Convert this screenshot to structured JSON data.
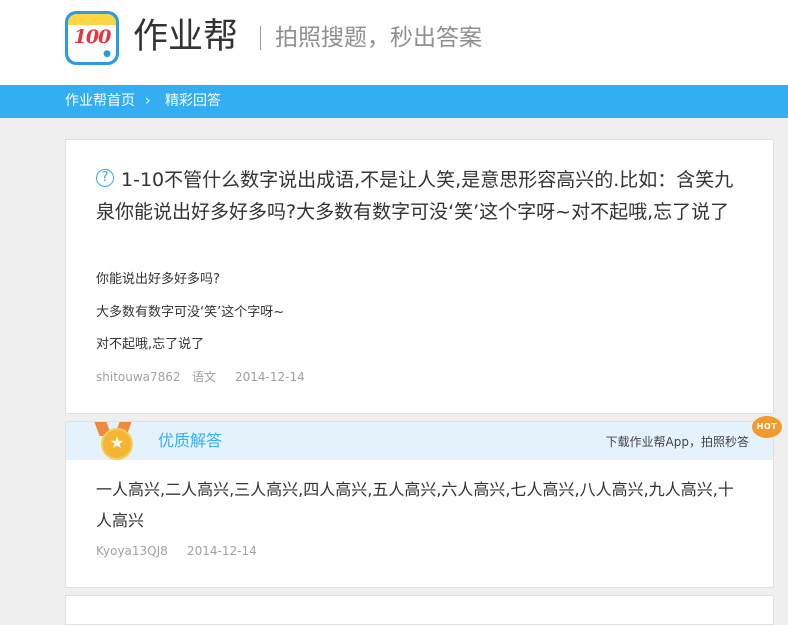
{
  "header": {
    "logo_text": "100",
    "brand": "作业帮",
    "slogan": "拍照搜题，秒出答案"
  },
  "breadcrumb": {
    "home": "作业帮首页",
    "separator": "›",
    "current": "精彩回答"
  },
  "question": {
    "icon": "?",
    "title": "1-10不管什么数字说出成语,不是让人笑,是意思形容高兴的.比如：含笑九泉你能说出好多好多吗?大多数有数字可没‘笑’这个字呀~对不起哦,忘了说了",
    "lines": [
      "你能说出好多好多吗?",
      "大多数有数字可没‘笑’这个字呀~",
      "对不起哦,忘了说了"
    ],
    "user": "shitouwa7862",
    "subject": "语文",
    "date": "2014-12-14"
  },
  "answer": {
    "label": "优质解答",
    "download_text": "下载作业帮App，拍照秒答",
    "hot_badge": "HOT",
    "text": "一人高兴,二人高兴,三人高兴,四人高兴,五人高兴,六人高兴,七人高兴,八人高兴,九人高兴,十人高兴",
    "user": "Kyoya13QJ8",
    "date": "2014-12-14"
  },
  "colors": {
    "accent": "#33aef3",
    "background": "#efefef",
    "medal": "#f5b534",
    "hot": "#f39a2e"
  }
}
